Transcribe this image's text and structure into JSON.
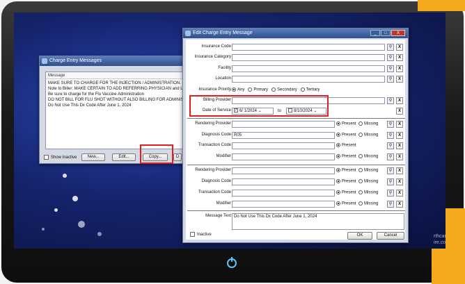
{
  "left_window": {
    "title": "Charge Entry Messages",
    "list_header": "Message",
    "messages": [
      "MAKE SURE TO CHARGE FOR THE INJECTION / ADMINISTRATION.",
      "Note to Biller: MAKE CERTAIN TO ADD REFERRING PHYSICIAN and LOC",
      "Be sure to charge for the Flu Vaccine Administration",
      "DO NOT BILL FOR FLU SHOT WITHOUT ALSO BILLING FOR ADMINISTR",
      "Do Not Use This Dx Code After June 1, 2024"
    ],
    "show_inactive": "Show Inactive",
    "new_btn": "New...",
    "edit_btn": "Edit...",
    "copy_btn": "Copy...",
    "next_btn_fragment": "D"
  },
  "right_window": {
    "title": "Edit Charge Entry Message",
    "controls": [
      "_",
      "□",
      "X"
    ],
    "fields": {
      "insurance_code": "Insurance Code",
      "insurance_category": "Insurance Category",
      "facility": "Facility",
      "location": "Location",
      "insurance_priority": "Insurance Priority",
      "billing_provider": "Billing Provider",
      "date_of_service": "Date of Service",
      "rendering_provider": "Rendering Provider",
      "diagnosis_code": "Diagnosis Code",
      "transaction_code": "Transaction Code",
      "modifier": "Modifier",
      "message_text": "Message Text"
    },
    "priority_options": [
      "Any",
      "Primary",
      "Secondary",
      "Tertiary"
    ],
    "date_from": "6/ 1/2024",
    "date_to_label": "to",
    "date_to": "8/10/2024",
    "diagnosis_value": "R05",
    "present": "Present",
    "missing": "Missing",
    "message_text_value": "Do Not Use This Dx Code After June 1, 2024",
    "inactive": "Inactive",
    "ok": "OK",
    "cancel": "Cancel"
  },
  "background_text": [
    "rthcare",
    "ire.com"
  ],
  "icons": {
    "search": "search-icon",
    "clear": "clear-x-icon",
    "power": "power-icon"
  }
}
